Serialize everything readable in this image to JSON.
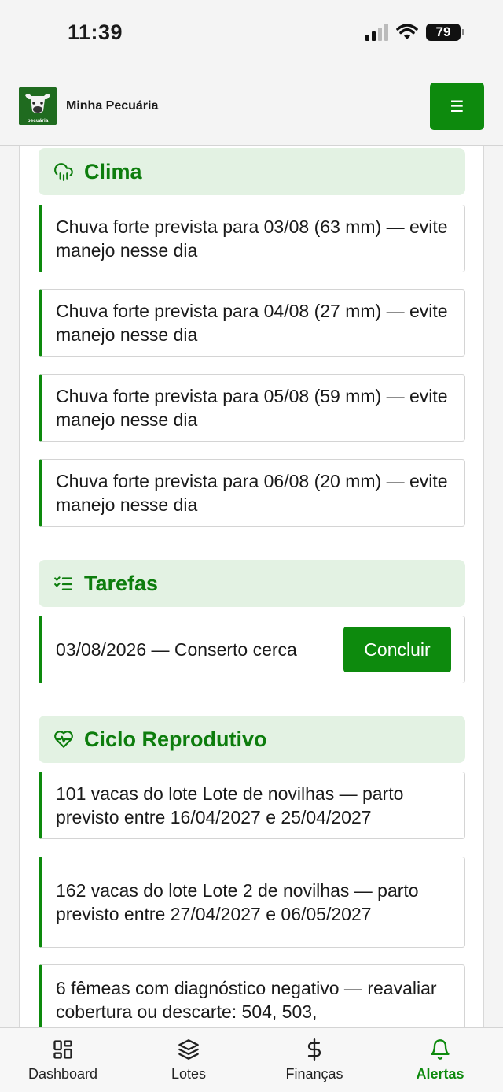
{
  "status_bar": {
    "time": "11:39",
    "battery": "79"
  },
  "header": {
    "app_title": "Minha Pecuária",
    "logo_text": "minha pecuária",
    "menu_icon": "hamburger-icon"
  },
  "sections": {
    "clima": {
      "title": "Clima",
      "icon": "cloud-rain-icon",
      "alerts": [
        "Chuva forte prevista para 03/08 (63 mm) — evite manejo nesse dia",
        "Chuva forte prevista para 04/08 (27 mm) — evite manejo nesse dia",
        "Chuva forte prevista para 05/08 (59 mm) — evite manejo nesse dia",
        "Chuva forte prevista para 06/08 (20 mm) — evite manejo nesse dia"
      ]
    },
    "tarefas": {
      "title": "Tarefas",
      "icon": "checklist-icon",
      "items": [
        {
          "text": "03/08/2026 — Conserto cerca",
          "button": "Concluir"
        }
      ]
    },
    "ciclo": {
      "title": "Ciclo Reprodutivo",
      "icon": "heart-pulse-icon",
      "alerts": [
        "101 vacas do lote Lote de novilhas — parto previsto entre 16/04/2027 e 25/04/2027",
        "162 vacas do lote Lote 2 de novilhas — parto previsto entre 27/04/2027 e 06/05/2027",
        "6 fêmeas com diagnóstico negativo — reavaliar cobertura ou descarte: 504, 503,"
      ]
    }
  },
  "bottom_nav": [
    {
      "label": "Dashboard",
      "icon": "dashboard-icon",
      "active": false
    },
    {
      "label": "Lotes",
      "icon": "layers-icon",
      "active": false
    },
    {
      "label": "Finanças",
      "icon": "dollar-icon",
      "active": false
    },
    {
      "label": "Alertas",
      "icon": "bell-icon",
      "active": true
    }
  ],
  "colors": {
    "accent": "#0d8a0d",
    "section_bg": "#e3f2e3",
    "section_title": "#0d7d0d"
  }
}
